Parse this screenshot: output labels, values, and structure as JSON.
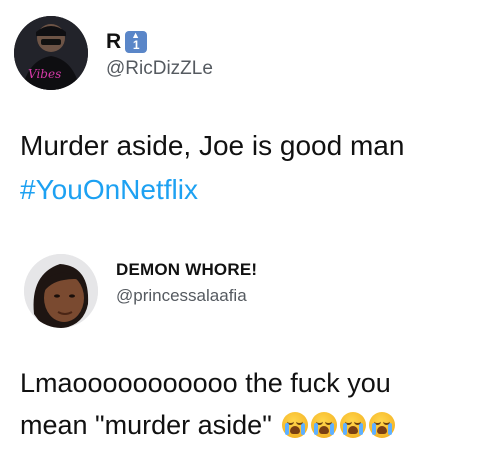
{
  "tweet1": {
    "display_name": "R",
    "badge_icon": "up-arrow-1-badge-icon",
    "badge_text": "1",
    "handle": "@RicDizZLe",
    "text_line1": "Murder aside, Joe is good man",
    "hashtag": "#YouOnNetflix",
    "colors": {
      "hashtag": "#1da1f2",
      "badge": "#5a86c8"
    }
  },
  "tweet2": {
    "display_name": "DEMON WHORE!",
    "handle": "@princessalaafia",
    "text_line1": "Lmaooooooooooo the fuck you",
    "text_line2": "mean \"murder aside\"",
    "emoji_icon": "loudly-crying-face-icon",
    "emoji_count": 4
  }
}
